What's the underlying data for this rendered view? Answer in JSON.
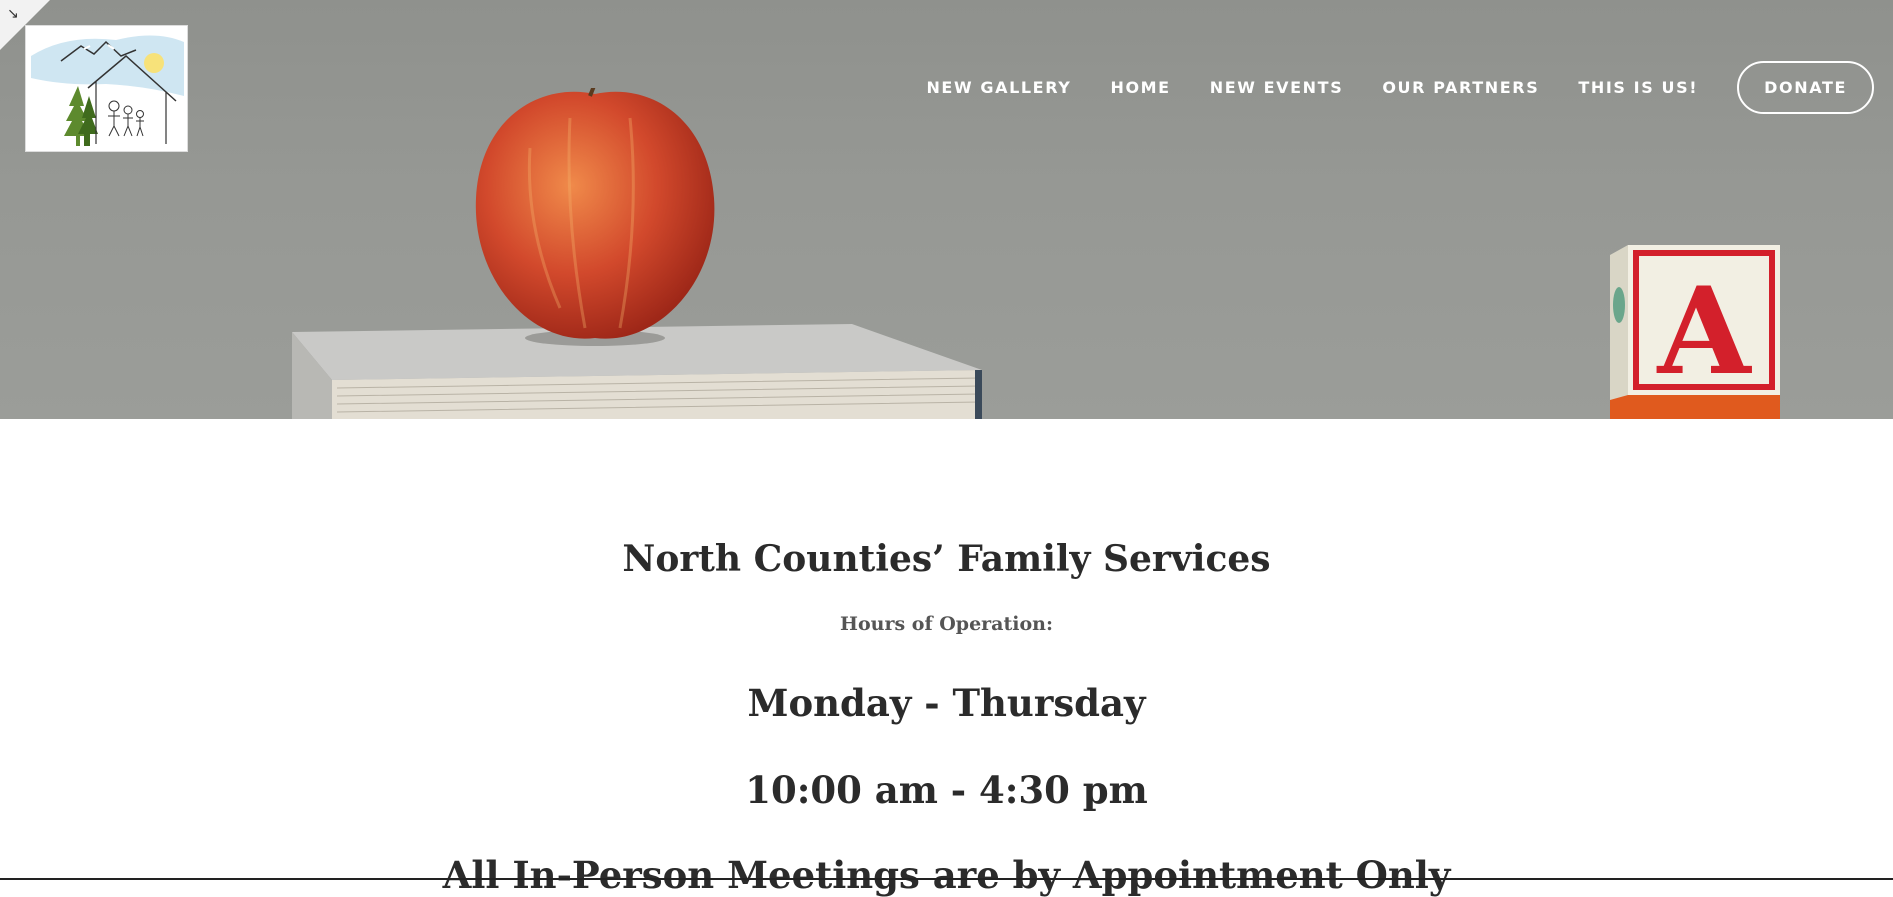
{
  "nav": {
    "items": [
      {
        "label": "NEW GALLERY"
      },
      {
        "label": "HOME"
      },
      {
        "label": "NEW EVENTS"
      },
      {
        "label": "OUR PARTNERS"
      },
      {
        "label": "THIS IS US!"
      }
    ],
    "donate_label": "DONATE"
  },
  "hero": {
    "block_letter": "A"
  },
  "content": {
    "org_title": "North Counties’ Family Services",
    "hours_label": "Hours of Operation:",
    "days": "Monday - Thursday",
    "time": "10:00 am - 4:30 pm",
    "notice_partial": "All In-Person Meetings are by Appointment Only"
  },
  "colors": {
    "hero_gray": "#969894",
    "apple_red": "#c8402a",
    "block_red": "#d3202b",
    "text_dark": "#2b2b2b"
  },
  "icons": {
    "corner": "collapse-arrow-icon",
    "logo": "family-house-logo"
  }
}
